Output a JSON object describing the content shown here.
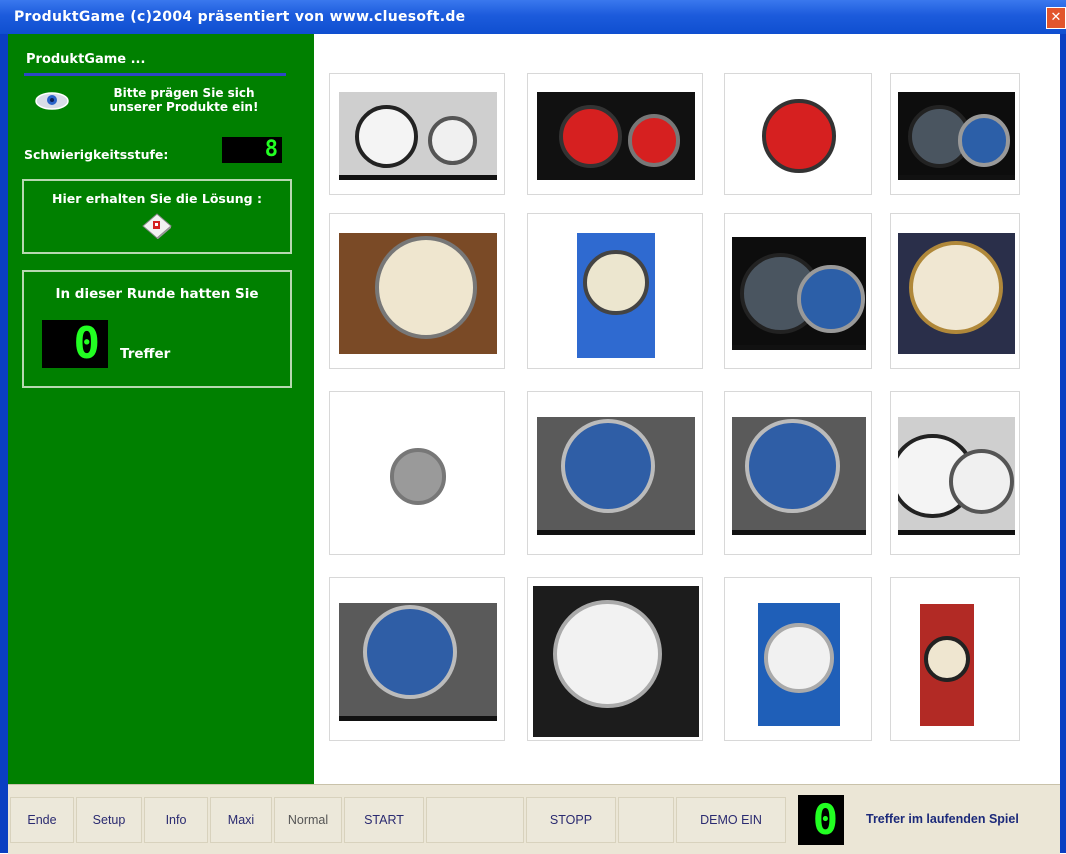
{
  "window": {
    "title": "ProduktGame (c)2004 präsentiert von www.cluesoft.de",
    "close_glyph": "✕"
  },
  "sidebar": {
    "title": "ProduktGame ...",
    "hint": "Bitte prägen Sie sich unserer Produkte ein!",
    "level_label": "Schwierigkeitsstufe:",
    "level_value": "8",
    "solution_label": "Hier erhalten Sie die Lösung :",
    "round_label": "In dieser Runde hatten Sie",
    "hits_value": "0",
    "hits_label": "Treffer",
    "icons": {
      "hint": "eye-icon",
      "solution": "solution-card-icon"
    }
  },
  "grid": {
    "rows": 4,
    "columns": 4,
    "items": [
      {
        "name": "watch-1",
        "style": "double-white-chrono"
      },
      {
        "name": "watch-2",
        "style": "double-red-chrono"
      },
      {
        "name": "watch-3",
        "style": "single-red-chrono"
      },
      {
        "name": "watch-4",
        "style": "double-blue-dark"
      },
      {
        "name": "watch-5",
        "style": "cream-leather-wood"
      },
      {
        "name": "watch-6",
        "style": "cream-blue-bg"
      },
      {
        "name": "watch-7",
        "style": "double-blue-dark"
      },
      {
        "name": "watch-8",
        "style": "cream-pocket-leather"
      },
      {
        "name": "watch-9",
        "style": "steel-small-white"
      },
      {
        "name": "watch-10",
        "style": "blue-chrono-steel"
      },
      {
        "name": "watch-11",
        "style": "blue-chrono-steel"
      },
      {
        "name": "watch-12",
        "style": "double-white-chrono"
      },
      {
        "name": "watch-13",
        "style": "blue-chrono-steel"
      },
      {
        "name": "watch-14",
        "style": "white-diver-steel"
      },
      {
        "name": "watch-15",
        "style": "white-blue-bg"
      },
      {
        "name": "watch-16",
        "style": "cream-red-bg"
      }
    ]
  },
  "toolbar": {
    "buttons": [
      {
        "key": "ende",
        "label": "Ende"
      },
      {
        "key": "setup",
        "label": "Setup"
      },
      {
        "key": "info",
        "label": "Info"
      },
      {
        "key": "maxi",
        "label": "Maxi"
      },
      {
        "key": "normal",
        "label": "Normal"
      },
      {
        "key": "start",
        "label": "START"
      },
      {
        "key": "blank1",
        "label": ""
      },
      {
        "key": "stopp",
        "label": "STOPP"
      },
      {
        "key": "blank2",
        "label": ""
      },
      {
        "key": "demo",
        "label": "DEMO EIN"
      }
    ],
    "counter_value": "0",
    "counter_label": "Treffer im laufenden Spiel"
  },
  "colors": {
    "sidebar_green": "#008000",
    "titlebar_blue": "#1c5bdc",
    "segment_green": "#22ff22",
    "toolbar_bg": "#ebe6d6"
  }
}
